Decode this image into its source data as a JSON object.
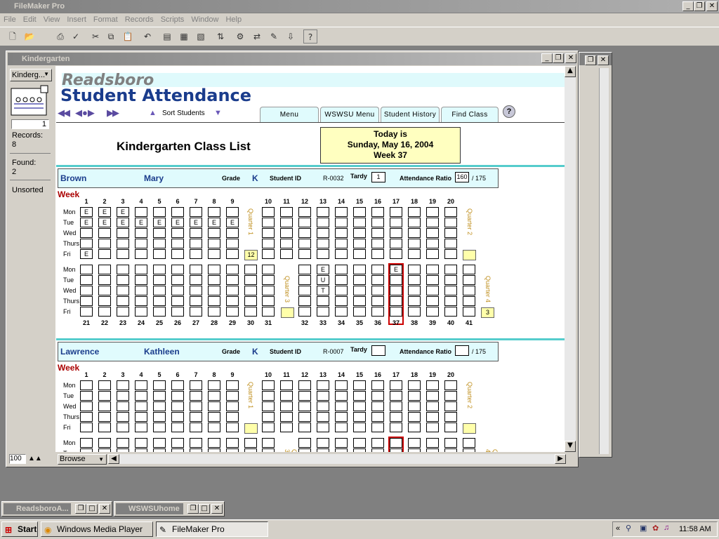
{
  "app": {
    "title": "FileMaker Pro"
  },
  "menu": [
    "File",
    "Edit",
    "View",
    "Insert",
    "Format",
    "Records",
    "Scripts",
    "Window",
    "Help"
  ],
  "window": {
    "title": "Kindergarten"
  },
  "status": {
    "layout": "Kinderg...",
    "page": "1",
    "records_label": "Records:",
    "records": "8",
    "found_label": "Found:",
    "found": "2",
    "sort": "Unsorted",
    "zoom": "100",
    "mode": "Browse"
  },
  "header": {
    "school": "Readsboro",
    "title": "Student Attendance",
    "sort_label": "Sort Students",
    "tabs": [
      "Menu",
      "WSWSU Menu",
      "Student History",
      "Find Class"
    ],
    "help": "?"
  },
  "list_title": "Kindergarten Class List",
  "today": {
    "line1": "Today is",
    "line2": "Sunday, May 16, 2004",
    "week_label": "Week",
    "week": "37"
  },
  "labels": {
    "grade": "Grade",
    "student_id": "Student ID",
    "tardy": "Tardy",
    "ratio": "Attendance Ratio",
    "of": "/ 175",
    "week": "Week"
  },
  "days": [
    "Mon",
    "Tue",
    "Wed",
    "Thurs",
    "Fri"
  ],
  "quarters": [
    "Quarter 1",
    "Quarter 2",
    "Quarter 3",
    "Quarter 4"
  ],
  "weeks_top": [
    "1",
    "2",
    "3",
    "4",
    "5",
    "6",
    "7",
    "8",
    "9",
    "10",
    "11",
    "12",
    "13",
    "14",
    "15",
    "16",
    "17",
    "18",
    "19",
    "20"
  ],
  "weeks_bottom": [
    "21",
    "22",
    "23",
    "24",
    "25",
    "26",
    "27",
    "28",
    "29",
    "30",
    "31",
    "32",
    "33",
    "34",
    "35",
    "36",
    "37",
    "38",
    "39",
    "40",
    "41"
  ],
  "students": [
    {
      "last": "Brown",
      "first": "Mary",
      "grade": "K",
      "id": "R-0032",
      "tardy": "1",
      "ratio": "160",
      "q1": "12",
      "q2": "",
      "q3": "",
      "q4": "3"
    },
    {
      "last": "Lawrence",
      "first": "Kathleen",
      "grade": "K",
      "id": "R-0007",
      "tardy": "",
      "ratio": "",
      "q1": "",
      "q2": "",
      "q3": "",
      "q4": ""
    }
  ],
  "attendance_marks": [
    {
      "week": "1",
      "day": "Mon",
      "mark": "E"
    },
    {
      "week": "1",
      "day": "Tue",
      "mark": "E"
    },
    {
      "week": "1",
      "day": "Fri",
      "mark": "E"
    },
    {
      "week": "2",
      "day": "Mon",
      "mark": "E"
    },
    {
      "week": "2",
      "day": "Tue",
      "mark": "E"
    },
    {
      "week": "3",
      "day": "Mon",
      "mark": "E"
    },
    {
      "week": "3",
      "day": "Tue",
      "mark": "E"
    },
    {
      "week": "4",
      "day": "Tue",
      "mark": "E"
    },
    {
      "week": "5",
      "day": "Tue",
      "mark": "E"
    },
    {
      "week": "6",
      "day": "Tue",
      "mark": "E"
    },
    {
      "week": "7",
      "day": "Tue",
      "mark": "E"
    },
    {
      "week": "8",
      "day": "Tue",
      "mark": "E"
    },
    {
      "week": "9",
      "day": "Tue",
      "mark": "E"
    },
    {
      "week": "33",
      "day": "Mon",
      "mark": "E"
    },
    {
      "week": "33",
      "day": "Tue",
      "mark": "U"
    },
    {
      "week": "33",
      "day": "Wed",
      "mark": "T"
    },
    {
      "week": "37",
      "day": "Mon",
      "mark": "E"
    }
  ],
  "taskbar": {
    "start": "Start",
    "items": [
      "Windows Media Player",
      "FileMaker Pro"
    ],
    "clock": "11:58 AM",
    "min1": "ReadsboroA...",
    "min2": "WSWSUhome"
  }
}
